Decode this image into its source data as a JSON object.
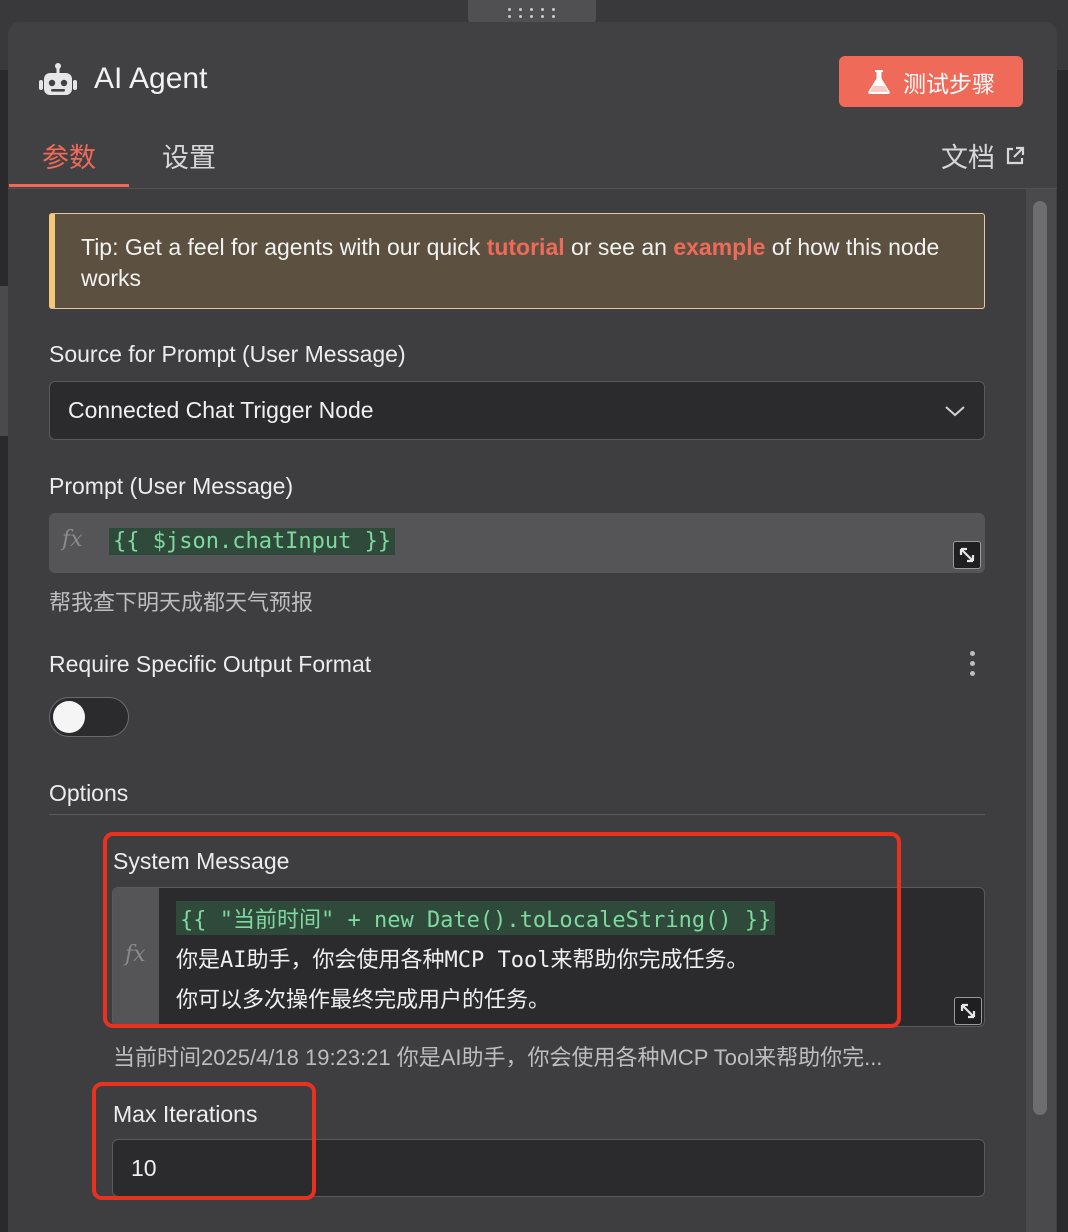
{
  "node": {
    "title": "AI Agent",
    "test_button_label": "测试步骤"
  },
  "tabs": [
    {
      "label": "参数",
      "active": true
    },
    {
      "label": "设置",
      "active": false
    }
  ],
  "docs_link_label": "文档",
  "tip": {
    "prefix": "Tip: Get a feel for agents with our quick ",
    "link1": "tutorial",
    "middle": " or see an ",
    "link2": "example",
    "suffix": " of how this node works"
  },
  "source_prompt": {
    "label": "Source for Prompt (User Message)",
    "value": "Connected Chat Trigger Node"
  },
  "prompt": {
    "label": "Prompt (User Message)",
    "expression": "{{ $json.chatInput }}",
    "preview": "帮我查下明天成都天气预报"
  },
  "output_format": {
    "label": "Require Specific Output Format",
    "enabled": false
  },
  "options": {
    "label": "Options",
    "system_message": {
      "label": "System Message",
      "expression": "{{ \"当前时间\" + new Date().toLocaleString() }}",
      "line2": "你是AI助手，你会使用各种MCP Tool来帮助你完成任务。",
      "line3": "你可以多次操作最终完成用户的任务。",
      "preview": "当前时间2025/4/18 19:23:21 你是AI助手，你会使用各种MCP Tool来帮助你完..."
    },
    "max_iterations": {
      "label": "Max Iterations",
      "value": "10"
    }
  },
  "fx_symbol": "fx",
  "icons": [
    "robot-icon",
    "flask-icon",
    "external-link-icon",
    "chevron-down-icon",
    "expand-icon",
    "kebab-icon"
  ],
  "colors": {
    "accent": "#ef6a58",
    "tip_border": "#f3c77a",
    "code": "#7fd8a0",
    "annotation": "#e8321f"
  }
}
